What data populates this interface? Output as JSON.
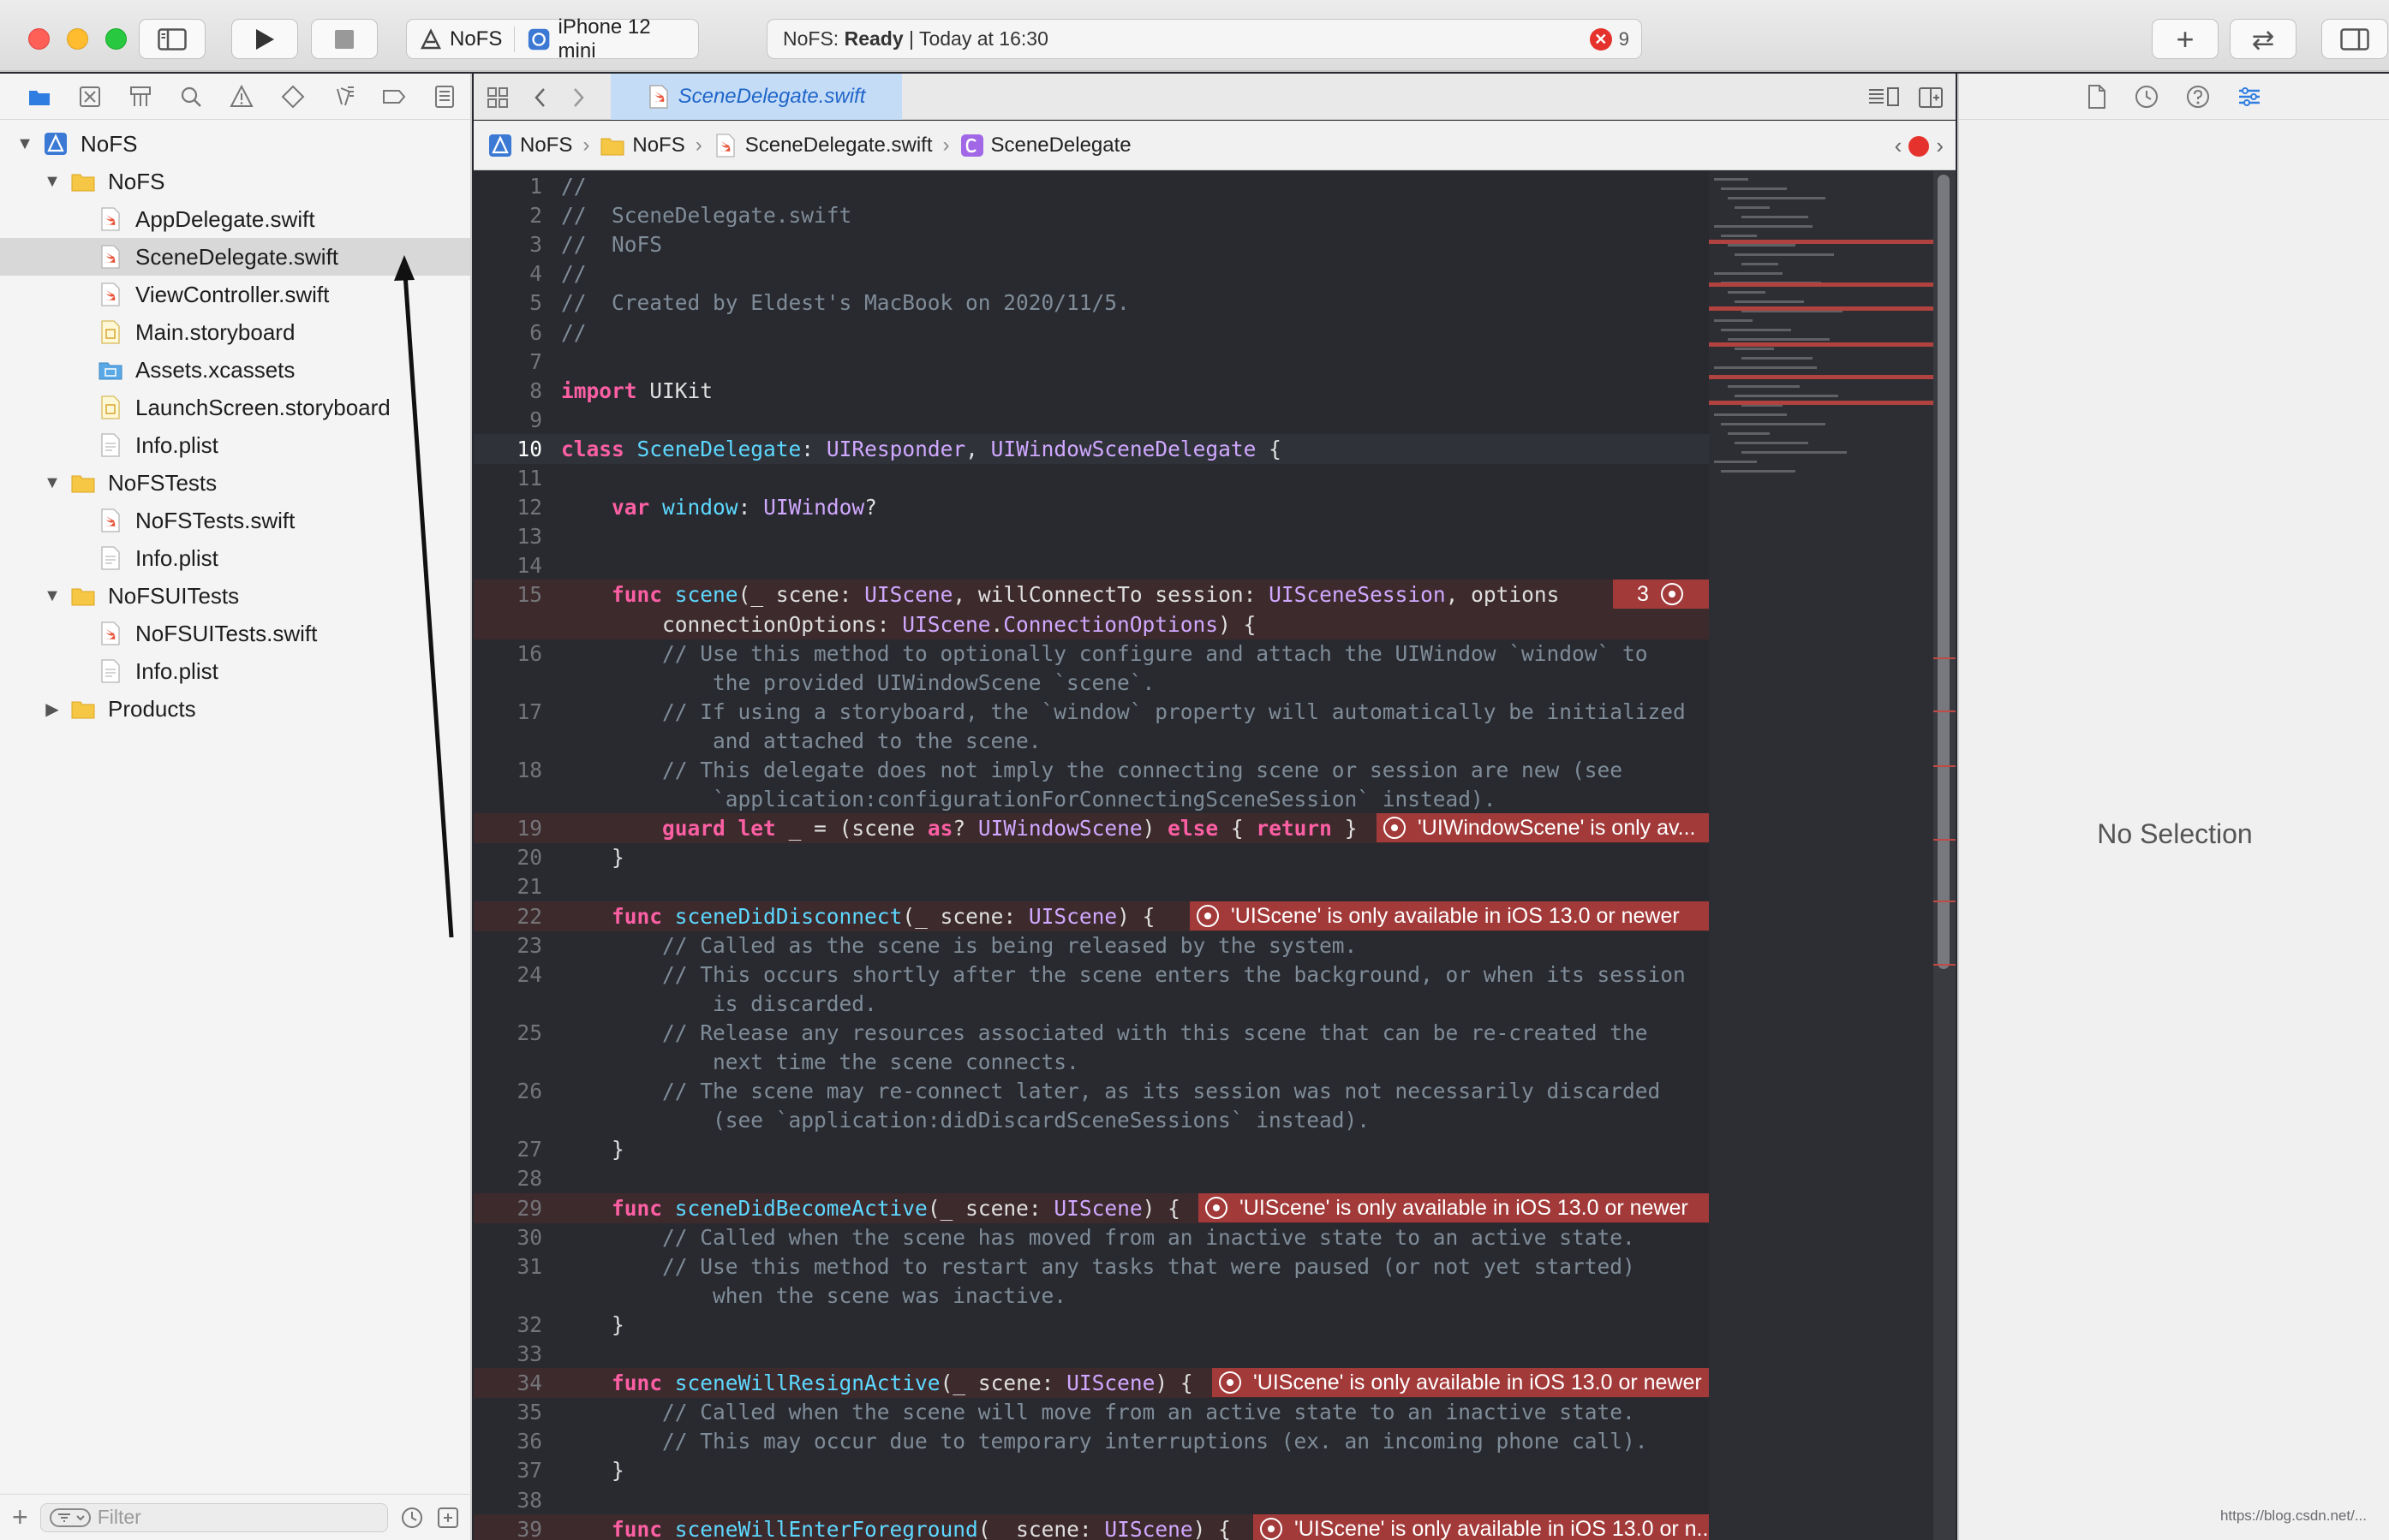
{
  "titlebar": {
    "run_label": "Run",
    "stop_label": "Stop",
    "scheme_project": "NoFS",
    "scheme_device": "iPhone 12 mini",
    "activity_prefix": "NoFS:",
    "activity_status": "Ready",
    "activity_time": "| Today at 16:30",
    "error_count": "9",
    "error_glyph": "✕",
    "add_glyph": "+",
    "swap_glyph": "⇄"
  },
  "navigator": {
    "tabs": [
      "folder-icon",
      "source-control-icon",
      "symbol-icon",
      "search-icon",
      "issue-icon",
      "test-icon",
      "debug-icon",
      "breakpoint-icon",
      "report-icon"
    ],
    "tree": [
      {
        "label": "NoFS",
        "indent": 0,
        "disclosure": "▼",
        "icon": "project-icon"
      },
      {
        "label": "NoFS",
        "indent": 1,
        "disclosure": "▼",
        "icon": "folder-icon"
      },
      {
        "label": "AppDelegate.swift",
        "indent": 2,
        "disclosure": "",
        "icon": "swift-file-icon"
      },
      {
        "label": "SceneDelegate.swift",
        "indent": 2,
        "disclosure": "",
        "icon": "swift-file-icon",
        "selected": true
      },
      {
        "label": "ViewController.swift",
        "indent": 2,
        "disclosure": "",
        "icon": "swift-file-icon"
      },
      {
        "label": "Main.storyboard",
        "indent": 2,
        "disclosure": "",
        "icon": "storyboard-icon"
      },
      {
        "label": "Assets.xcassets",
        "indent": 2,
        "disclosure": "",
        "icon": "assets-folder-icon"
      },
      {
        "label": "LaunchScreen.storyboard",
        "indent": 2,
        "disclosure": "",
        "icon": "storyboard-icon"
      },
      {
        "label": "Info.plist",
        "indent": 2,
        "disclosure": "",
        "icon": "plist-file-icon"
      },
      {
        "label": "NoFSTests",
        "indent": 1,
        "disclosure": "▼",
        "icon": "folder-icon"
      },
      {
        "label": "NoFSTests.swift",
        "indent": 2,
        "disclosure": "",
        "icon": "swift-file-icon"
      },
      {
        "label": "Info.plist",
        "indent": 2,
        "disclosure": "",
        "icon": "plist-file-icon"
      },
      {
        "label": "NoFSUITests",
        "indent": 1,
        "disclosure": "▼",
        "icon": "folder-icon"
      },
      {
        "label": "NoFSUITests.swift",
        "indent": 2,
        "disclosure": "",
        "icon": "swift-file-icon"
      },
      {
        "label": "Info.plist",
        "indent": 2,
        "disclosure": "",
        "icon": "plist-file-icon"
      },
      {
        "label": "Products",
        "indent": 1,
        "disclosure": "▶",
        "icon": "folder-icon"
      }
    ],
    "filter_placeholder": "Filter",
    "add_glyph": "+"
  },
  "editor": {
    "tab_title": "SceneDelegate.swift",
    "breadcrumb": [
      "NoFS",
      "NoFS",
      "SceneDelegate.swift",
      "SceneDelegate"
    ],
    "current_line": "10",
    "lines": [
      {
        "n": "1",
        "segs": [
          [
            "cm",
            "//"
          ]
        ]
      },
      {
        "n": "2",
        "segs": [
          [
            "cm",
            "//  SceneDelegate.swift"
          ]
        ]
      },
      {
        "n": "3",
        "segs": [
          [
            "cm",
            "//  NoFS"
          ]
        ]
      },
      {
        "n": "4",
        "segs": [
          [
            "cm",
            "//"
          ]
        ]
      },
      {
        "n": "5",
        "segs": [
          [
            "cm",
            "//  Created by Eldest's MacBook on 2020/11/5."
          ]
        ]
      },
      {
        "n": "6",
        "segs": [
          [
            "cm",
            "//"
          ]
        ]
      },
      {
        "n": "7",
        "segs": []
      },
      {
        "n": "8",
        "segs": [
          [
            "kw",
            "import"
          ],
          [
            "pl",
            " UIKit"
          ]
        ]
      },
      {
        "n": "9",
        "segs": []
      },
      {
        "n": "10",
        "segs": [
          [
            "kw",
            "class"
          ],
          [
            "pl",
            " "
          ],
          [
            "dc",
            "SceneDelegate"
          ],
          [
            "pl",
            ": "
          ],
          [
            "ty",
            "UIResponder"
          ],
          [
            "pl",
            ", "
          ],
          [
            "ty",
            "UIWindowSceneDelegate"
          ],
          [
            "pl",
            " {"
          ]
        ],
        "current": true
      },
      {
        "n": "11",
        "segs": []
      },
      {
        "n": "12",
        "segs": [
          [
            "pl",
            "    "
          ],
          [
            "kw",
            "var"
          ],
          [
            "pl",
            " "
          ],
          [
            "dc",
            "window"
          ],
          [
            "pl",
            ": "
          ],
          [
            "ty",
            "UIWindow"
          ],
          [
            "pl",
            "?"
          ]
        ]
      },
      {
        "n": "13",
        "segs": []
      },
      {
        "n": "14",
        "segs": []
      },
      {
        "n": "15",
        "segs": [
          [
            "pl",
            "    "
          ],
          [
            "kw",
            "func"
          ],
          [
            "pl",
            " "
          ],
          [
            "dc",
            "scene"
          ],
          [
            "pl",
            "(_ scene: "
          ],
          [
            "ty",
            "UIScene"
          ],
          [
            "pl",
            ", willConnectTo session: "
          ],
          [
            "ty",
            "UISceneSession"
          ],
          [
            "pl",
            ", options"
          ]
        ],
        "error": true,
        "badge": "3"
      },
      {
        "n": "",
        "segs": [
          [
            "pl",
            "        connectionOptions: "
          ],
          [
            "ty",
            "UIScene"
          ],
          [
            "pl",
            "."
          ],
          [
            "ty",
            "ConnectionOptions"
          ],
          [
            "pl",
            ") {"
          ]
        ],
        "error": true
      },
      {
        "n": "16",
        "segs": [
          [
            "cm",
            "        // Use this method to optionally configure and attach the UIWindow `window` to"
          ]
        ]
      },
      {
        "n": "",
        "segs": [
          [
            "cm",
            "            the provided UIWindowScene `scene`."
          ]
        ]
      },
      {
        "n": "17",
        "segs": [
          [
            "cm",
            "        // If using a storyboard, the `window` property will automatically be initialized"
          ]
        ]
      },
      {
        "n": "",
        "segs": [
          [
            "cm",
            "            and attached to the scene."
          ]
        ]
      },
      {
        "n": "18",
        "segs": [
          [
            "cm",
            "        // This delegate does not imply the connecting scene or session are new (see"
          ]
        ]
      },
      {
        "n": "",
        "segs": [
          [
            "cm",
            "            `application:configurationForConnectingSceneSession` instead)."
          ]
        ]
      },
      {
        "n": "19",
        "segs": [
          [
            "pl",
            "        "
          ],
          [
            "kw",
            "guard"
          ],
          [
            "pl",
            " "
          ],
          [
            "kw",
            "let"
          ],
          [
            "pl",
            " _ = (scene "
          ],
          [
            "kw",
            "as"
          ],
          [
            "pl",
            "? "
          ],
          [
            "ty",
            "UIWindowScene"
          ],
          [
            "pl",
            ") "
          ],
          [
            "kw",
            "else"
          ],
          [
            "pl",
            " { "
          ],
          [
            "kw",
            "return"
          ],
          [
            "pl",
            " }"
          ]
        ],
        "error": true,
        "msg": "'UIWindowScene' is only av...",
        "msg_w": 388
      },
      {
        "n": "20",
        "segs": [
          [
            "pl",
            "    }"
          ]
        ]
      },
      {
        "n": "21",
        "segs": []
      },
      {
        "n": "22",
        "segs": [
          [
            "pl",
            "    "
          ],
          [
            "kw",
            "func"
          ],
          [
            "pl",
            " "
          ],
          [
            "dc",
            "sceneDidDisconnect"
          ],
          [
            "pl",
            "(_ scene: "
          ],
          [
            "ty",
            "UIScene"
          ],
          [
            "pl",
            ") {"
          ]
        ],
        "error": true,
        "msg": "'UIScene' is only available in iOS 13.0 or newer",
        "msg_w": 606
      },
      {
        "n": "23",
        "segs": [
          [
            "cm",
            "        // Called as the scene is being released by the system."
          ]
        ]
      },
      {
        "n": "24",
        "segs": [
          [
            "cm",
            "        // This occurs shortly after the scene enters the background, or when its session"
          ]
        ]
      },
      {
        "n": "",
        "segs": [
          [
            "cm",
            "            is discarded."
          ]
        ]
      },
      {
        "n": "25",
        "segs": [
          [
            "cm",
            "        // Release any resources associated with this scene that can be re-created the"
          ]
        ]
      },
      {
        "n": "",
        "segs": [
          [
            "cm",
            "            next time the scene connects."
          ]
        ]
      },
      {
        "n": "26",
        "segs": [
          [
            "cm",
            "        // The scene may re-connect later, as its session was not necessarily discarded"
          ]
        ]
      },
      {
        "n": "",
        "segs": [
          [
            "cm",
            "            (see `application:didDiscardSceneSessions` instead)."
          ]
        ]
      },
      {
        "n": "27",
        "segs": [
          [
            "pl",
            "    }"
          ]
        ]
      },
      {
        "n": "28",
        "segs": []
      },
      {
        "n": "29",
        "segs": [
          [
            "pl",
            "    "
          ],
          [
            "kw",
            "func"
          ],
          [
            "pl",
            " "
          ],
          [
            "dc",
            "sceneDidBecomeActive"
          ],
          [
            "pl",
            "(_ scene: "
          ],
          [
            "ty",
            "UIScene"
          ],
          [
            "pl",
            ") {"
          ]
        ],
        "error": true,
        "msg": "'UIScene' is only available in iOS 13.0 or newer",
        "msg_w": 596
      },
      {
        "n": "30",
        "segs": [
          [
            "cm",
            "        // Called when the scene has moved from an inactive state to an active state."
          ]
        ]
      },
      {
        "n": "31",
        "segs": [
          [
            "cm",
            "        // Use this method to restart any tasks that were paused (or not yet started)"
          ]
        ]
      },
      {
        "n": "",
        "segs": [
          [
            "cm",
            "            when the scene was inactive."
          ]
        ]
      },
      {
        "n": "32",
        "segs": [
          [
            "pl",
            "    }"
          ]
        ]
      },
      {
        "n": "33",
        "segs": []
      },
      {
        "n": "34",
        "segs": [
          [
            "pl",
            "    "
          ],
          [
            "kw",
            "func"
          ],
          [
            "pl",
            " "
          ],
          [
            "dc",
            "sceneWillResignActive"
          ],
          [
            "pl",
            "(_ scene: "
          ],
          [
            "ty",
            "UIScene"
          ],
          [
            "pl",
            ") {"
          ]
        ],
        "error": true,
        "msg": "'UIScene' is only available in iOS 13.0 or newer",
        "msg_w": 580
      },
      {
        "n": "35",
        "segs": [
          [
            "cm",
            "        // Called when the scene will move from an active state to an inactive state."
          ]
        ]
      },
      {
        "n": "36",
        "segs": [
          [
            "cm",
            "        // This may occur due to temporary interruptions (ex. an incoming phone call)."
          ]
        ]
      },
      {
        "n": "37",
        "segs": [
          [
            "pl",
            "    }"
          ]
        ]
      },
      {
        "n": "38",
        "segs": []
      },
      {
        "n": "39",
        "segs": [
          [
            "pl",
            "    "
          ],
          [
            "kw",
            "func"
          ],
          [
            "pl",
            " "
          ],
          [
            "dc",
            "sceneWillEnterForeground"
          ],
          [
            "pl",
            "(_ scene: "
          ],
          [
            "ty",
            "UIScene"
          ],
          [
            "pl",
            ") {"
          ]
        ],
        "error": true,
        "msg": "'UIScene' is only available in iOS 13.0 or n...",
        "msg_w": 532
      }
    ]
  },
  "inspector": {
    "tabs": [
      "file-inspector-icon",
      "history-icon",
      "quick-help-icon",
      "attributes-icon"
    ],
    "empty_text": "No Selection"
  },
  "watermark": "https://blog.csdn.net/..."
}
